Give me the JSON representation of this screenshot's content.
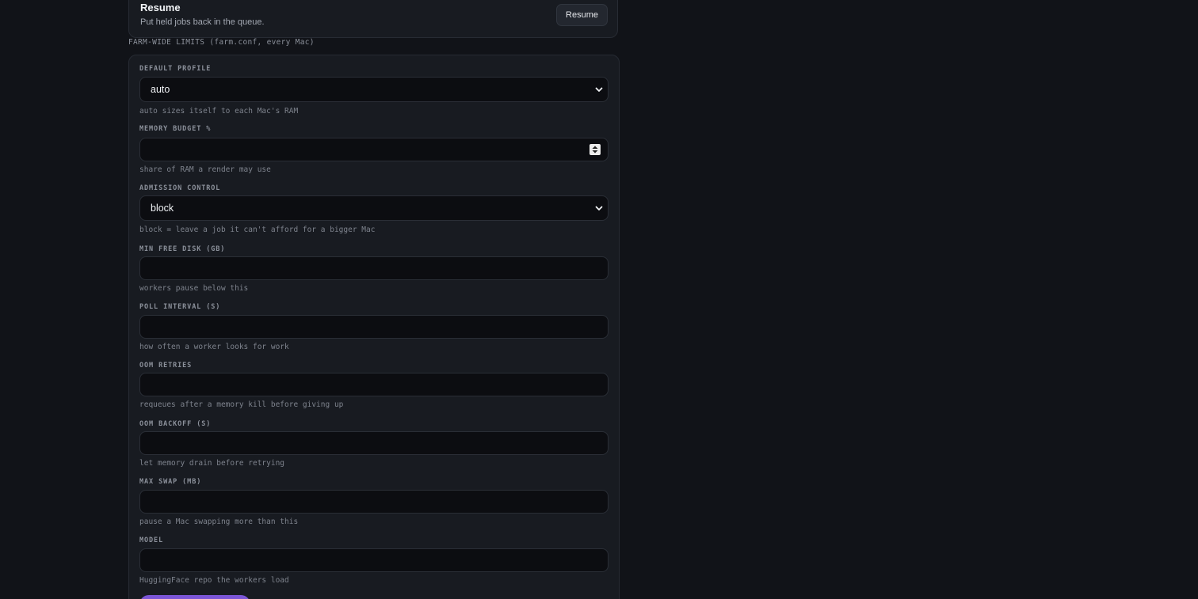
{
  "resume_action": {
    "title": "Resume",
    "description": "Put held jobs back in the queue.",
    "button_label": "Resume"
  },
  "farm_limits": {
    "heading": "FARM-WIDE LIMITS (farm.conf, every Mac)",
    "fields": [
      {
        "label": "DEFAULT PROFILE",
        "type": "select",
        "value": "auto",
        "help": "auto sizes itself to each Mac's RAM"
      },
      {
        "label": "MEMORY BUDGET %",
        "type": "number",
        "value": "",
        "help": "share of RAM a render may use"
      },
      {
        "label": "ADMISSION CONTROL",
        "type": "select",
        "value": "block",
        "help": "block = leave a job it can't afford for a bigger Mac"
      },
      {
        "label": "MIN FREE DISK (GB)",
        "type": "text",
        "value": "",
        "help": "workers pause below this"
      },
      {
        "label": "POLL INTERVAL (S)",
        "type": "text",
        "value": "",
        "help": "how often a worker looks for work"
      },
      {
        "label": "OOM RETRIES",
        "type": "text",
        "value": "",
        "help": "requeues after a memory kill before giving up"
      },
      {
        "label": "OOM BACKOFF (S)",
        "type": "text",
        "value": "",
        "help": "let memory drain before retrying"
      },
      {
        "label": "MAX SWAP (MB)",
        "type": "text",
        "value": "",
        "help": "pause a Mac swapping more than this"
      },
      {
        "label": "MODEL",
        "type": "text",
        "value": "",
        "help": "HuggingFace repo the workers load"
      }
    ]
  },
  "colors": {
    "page_bg": "#111318",
    "card_bg": "#181b21",
    "input_bg": "#0c0d11",
    "accent": "#7b55d6"
  },
  "icons": {
    "select_arrow": "chevron-down-icon",
    "number_spinner": "stepper-icon"
  }
}
